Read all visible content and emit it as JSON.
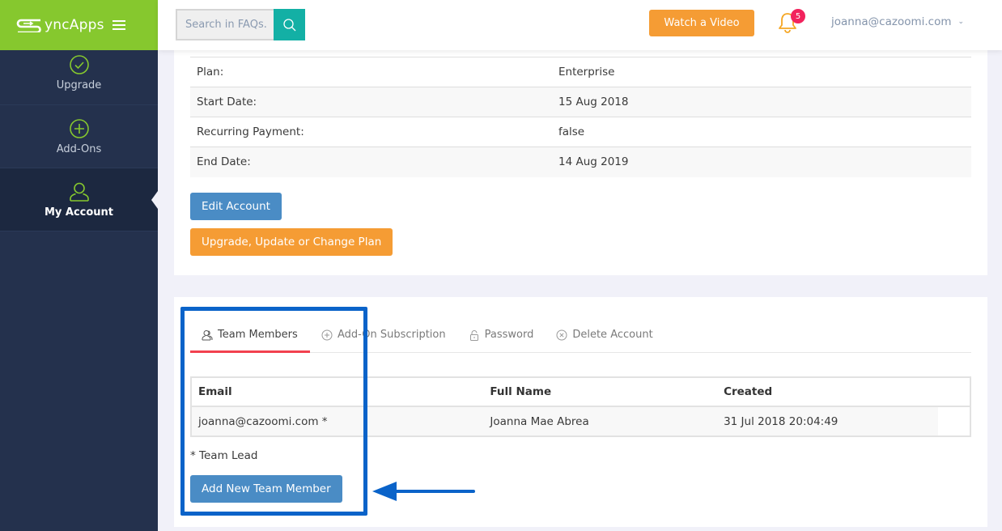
{
  "brand": {
    "name": "SyncApps",
    "color": "#86c82e"
  },
  "header": {
    "search": {
      "placeholder": "Search in FAQs.",
      "value": "",
      "icon": "search-icon"
    },
    "watch_video_label": "Watch a Video",
    "notifications": {
      "icon": "bell-icon",
      "count": "5"
    },
    "user_email": "joanna@cazoomi.com",
    "user_menu_icon": "chevron-down-icon"
  },
  "sidebar": {
    "items": [
      {
        "label": "Upgrade",
        "icon": "check-circle-icon",
        "active": false
      },
      {
        "label": "Add-Ons",
        "icon": "plus-circle-icon",
        "active": false
      },
      {
        "label": "My Account",
        "icon": "user-icon",
        "active": true
      }
    ]
  },
  "account": {
    "rows": [
      {
        "label": "Plan:",
        "value": "Enterprise"
      },
      {
        "label": "Start Date:",
        "value": "15 Aug 2018"
      },
      {
        "label": "Recurring Payment:",
        "value": "false"
      },
      {
        "label": "End Date:",
        "value": "14 Aug 2019"
      }
    ],
    "edit_label": "Edit Account",
    "upgrade_label": "Upgrade, Update or Change Plan"
  },
  "tabs": [
    {
      "label": "Team Members",
      "icon": "users-icon",
      "active": true
    },
    {
      "label": "Add-On Subscription",
      "icon": "plus-circle-icon",
      "active": false
    },
    {
      "label": "Password",
      "icon": "lock-icon",
      "active": false
    },
    {
      "label": "Delete Account",
      "icon": "x-circle-icon",
      "active": false
    }
  ],
  "team": {
    "columns": [
      "Email",
      "Full Name",
      "Created"
    ],
    "rows": [
      {
        "email": "joanna@cazoomi.com *",
        "full_name": "Joanna Mae Abrea",
        "created": "31 Jul 2018 20:04:49"
      }
    ],
    "footnote": "* Team Lead",
    "add_label": "Add New Team Member"
  },
  "annotation": {
    "highlight_color": "#0a63c9",
    "arrow_icon": "arrow-left-icon"
  }
}
